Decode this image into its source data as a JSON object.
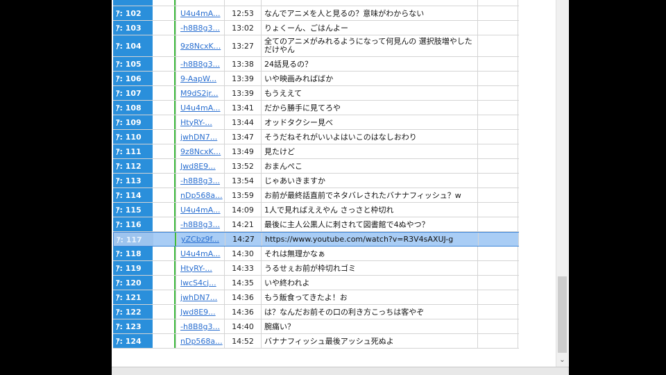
{
  "posts": [
    {
      "no": "ｱ: 102",
      "id": "U4u4mA...",
      "time": "12:53",
      "msg": "なんでアニメを人と見るの？意味がわからない"
    },
    {
      "no": "ｱ: 103",
      "id": "-h8B8g3...",
      "time": "13:02",
      "msg": "りょくーん、ごはんよー"
    },
    {
      "no": "ｱ: 104",
      "id": "9z8NcxK...",
      "time": "13:27",
      "msg": "全てのアニメがみれるようになって何見んの 選択肢増やしただけやん"
    },
    {
      "no": "ｱ: 105",
      "id": "-h8B8g3...",
      "time": "13:38",
      "msg": "24話見るの？"
    },
    {
      "no": "ｱ: 106",
      "id": "9-AapW...",
      "time": "13:39",
      "msg": "いや映画みればばか"
    },
    {
      "no": "ｱ: 107",
      "id": "M9dS2jr...",
      "time": "13:39",
      "msg": "もうええて"
    },
    {
      "no": "ｱ: 108",
      "id": "U4u4mA...",
      "time": "13:41",
      "msg": "だから勝手に見てろや"
    },
    {
      "no": "ｱ: 109",
      "id": "HtyRY-...",
      "time": "13:44",
      "msg": "オッドタクシー見べ"
    },
    {
      "no": "ｱ: 110",
      "id": "jwhDN7...",
      "time": "13:47",
      "msg": "そうだねそれがいいよはいこのはなしおわり"
    },
    {
      "no": "ｱ: 111",
      "id": "9z8NcxK...",
      "time": "13:49",
      "msg": "見たけど"
    },
    {
      "no": "ｱ: 112",
      "id": "Jwd8E9...",
      "time": "13:52",
      "msg": "おまんぺこ"
    },
    {
      "no": "ｱ: 113",
      "id": "-h8B8g3...",
      "time": "13:54",
      "msg": "じゃあいきますか"
    },
    {
      "no": "ｱ: 114",
      "id": "nDp568a...",
      "time": "13:59",
      "msg": "お前が最終話直前でネタバレされたバナナフィッシュ？w"
    },
    {
      "no": "ｱ: 115",
      "id": "U4u4mA...",
      "time": "14:09",
      "msg": "1人で見ればええやん さっさと枠切れ"
    },
    {
      "no": "ｱ: 116",
      "id": "-h8B8g3...",
      "time": "14:21",
      "msg": "最後に主人公黒人に刺されて図書館で4ぬやつ？"
    },
    {
      "no": "ｱ: 117",
      "id": "yZCbz9f...",
      "time": "14:27",
      "msg": "https://www.youtube.com/watch?v=R3V4sAXUJ-g"
    },
    {
      "no": "ｱ: 118",
      "id": "U4u4mA...",
      "time": "14:30",
      "msg": "それは無理かなぁ"
    },
    {
      "no": "ｱ: 119",
      "id": "HtyRY-...",
      "time": "14:33",
      "msg": "うるせぇお前が枠切れゴミ"
    },
    {
      "no": "ｱ: 120",
      "id": "lwcS4cj...",
      "time": "14:35",
      "msg": "いや終われよ"
    },
    {
      "no": "ｱ: 121",
      "id": "jwhDN7...",
      "time": "14:36",
      "msg": "もう飯食ってきたよ！お"
    },
    {
      "no": "ｱ: 122",
      "id": "Jwd8E9...",
      "time": "14:36",
      "msg": "は？なんだお前その口の利き方こっちは客やぞ"
    },
    {
      "no": "ｱ: 123",
      "id": "-h8B8g3...",
      "time": "14:40",
      "msg": "腕痛い？"
    },
    {
      "no": "ｱ: 124",
      "id": "nDp568a...",
      "time": "14:52",
      "msg": "バナナフィッシュ最後アッシュ死ぬよ"
    }
  ],
  "selected_post": "ｱ: 117",
  "colors": {
    "number_bg": "#2a8fdb",
    "marker": "#3dbb3d",
    "link": "#2a6fd0",
    "selection": "#a9cdf5"
  },
  "icons": {
    "scroll_down": "chevron-down-icon"
  }
}
